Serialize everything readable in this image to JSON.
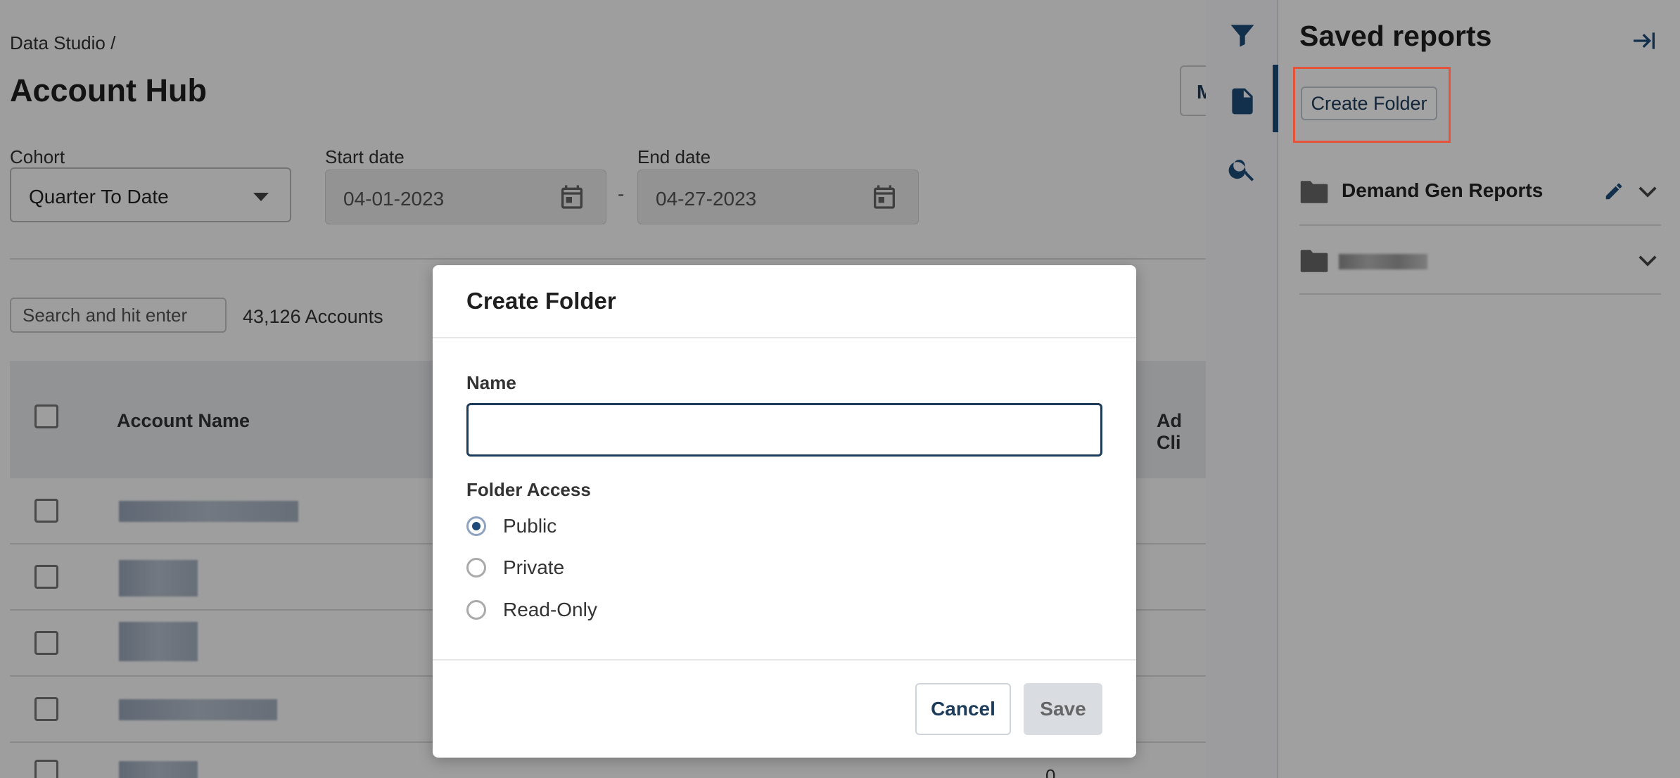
{
  "page": {
    "breadcrumb": "Data Studio /",
    "title": "Account Hub",
    "top_right_button": "M"
  },
  "filters": {
    "cohort": {
      "label": "Cohort",
      "value": "Quarter To Date"
    },
    "start_date": {
      "label": "Start date",
      "value": "04-01-2023"
    },
    "date_separator": "-",
    "end_date": {
      "label": "End date",
      "value": "04-27-2023"
    }
  },
  "search": {
    "placeholder": "Search and hit enter"
  },
  "account_count": "43,126 Accounts",
  "table": {
    "columns": [
      "Account Name",
      "Ad Cli"
    ],
    "partial_cell_value": "0"
  },
  "drawer": {
    "title": "Saved reports",
    "create_folder_label": "Create Folder",
    "folders": [
      {
        "name": "Demand Gen Reports"
      }
    ],
    "icons": [
      "filter-icon",
      "document-icon",
      "search-icon",
      "collapse-right-icon",
      "folder-icon",
      "pencil-icon",
      "chevron-down-icon"
    ]
  },
  "modal": {
    "title": "Create Folder",
    "name_label": "Name",
    "name_value": "",
    "access_label": "Folder Access",
    "access_options": [
      {
        "label": "Public",
        "selected": true
      },
      {
        "label": "Private",
        "selected": false
      },
      {
        "label": "Read-Only",
        "selected": false
      }
    ],
    "cancel_label": "Cancel",
    "save_label": "Save"
  },
  "colors": {
    "accent": "#1d4a78",
    "highlight": "#e5533a"
  }
}
